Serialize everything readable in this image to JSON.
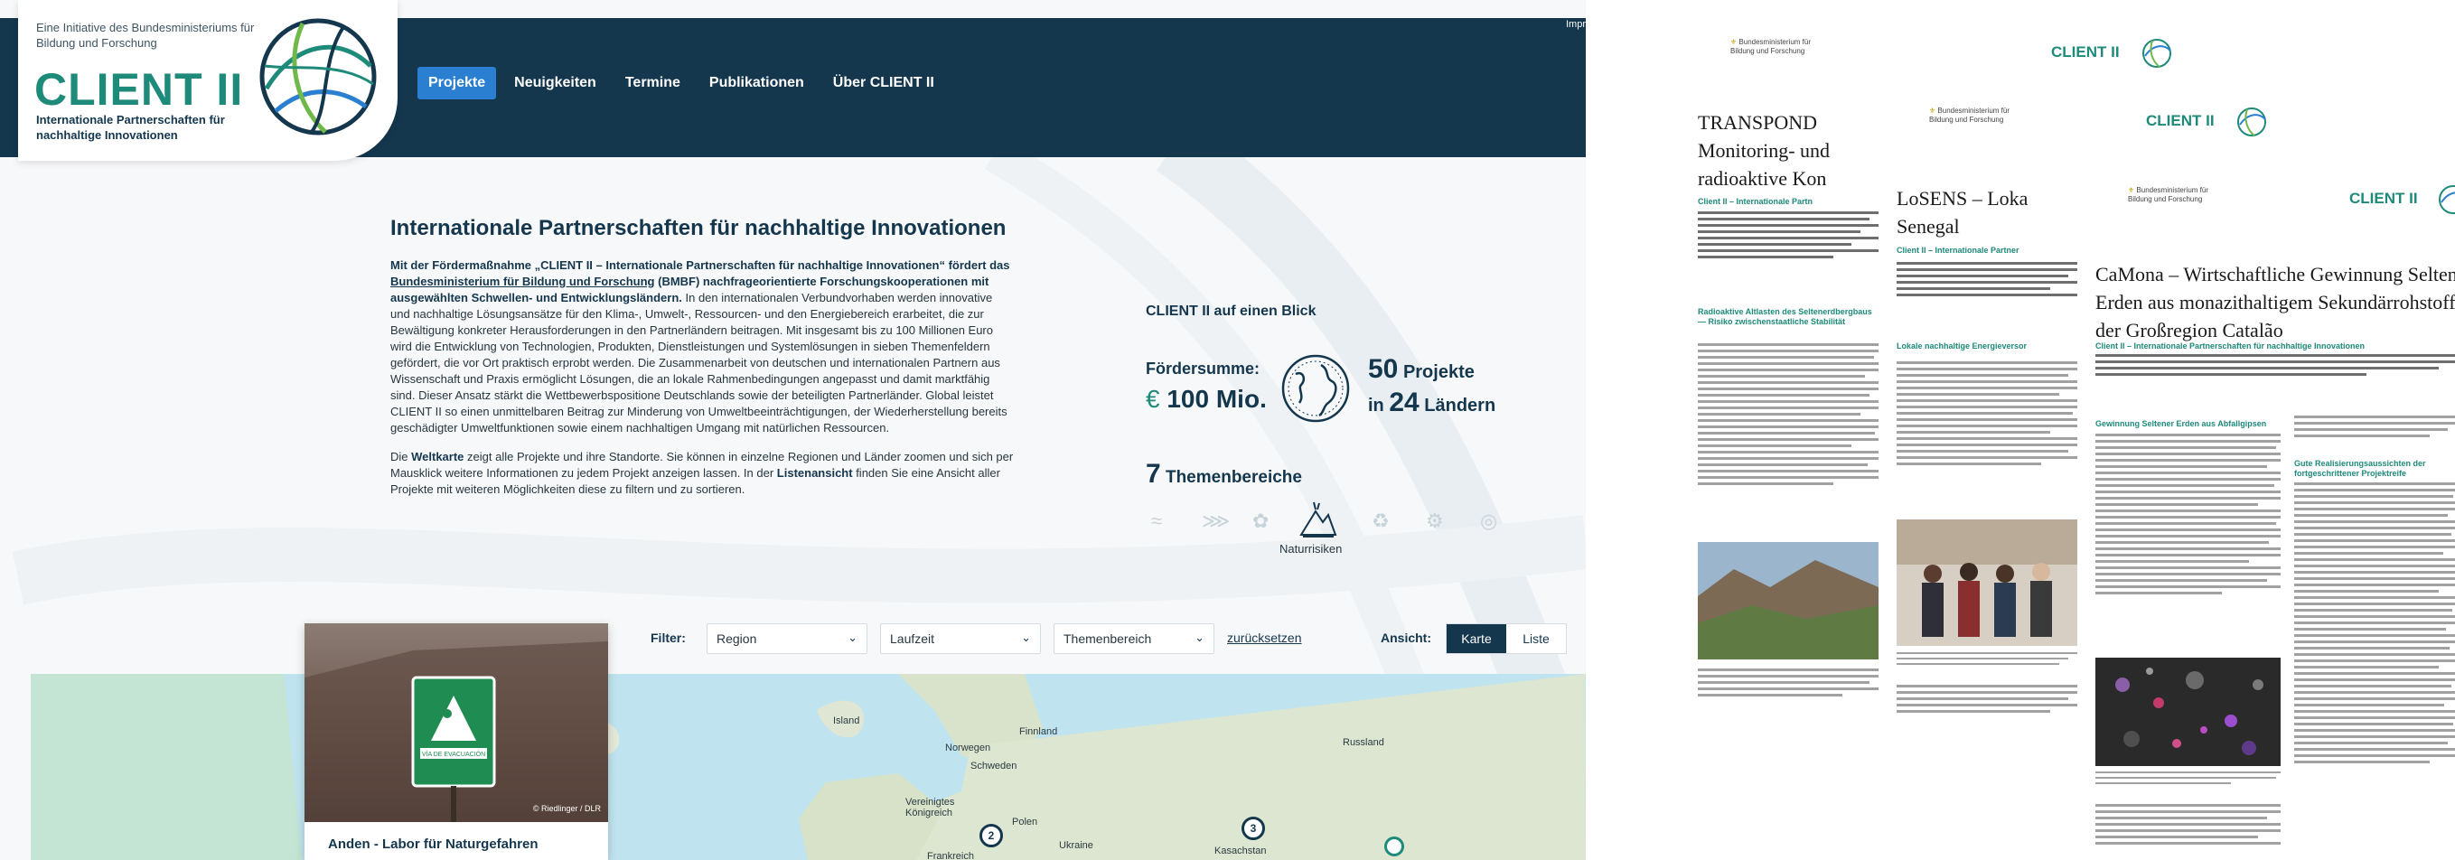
{
  "site": {
    "logo": {
      "initiative": "Eine Initiative des Bundesministeriums für Bildung und Forschung",
      "title": "CLIENT II",
      "subtitle": "Internationale Partnerschaften für nachhaltige Innovationen"
    },
    "nav": {
      "items": [
        "Projekte",
        "Neuigkeiten",
        "Termine",
        "Publikationen",
        "Über CLIENT II"
      ],
      "active": "Projekte",
      "imprint": "Impr"
    },
    "intro": {
      "heading": "Internationale Partnerschaften für nachhaltige Innovationen",
      "p1_bold1": "Mit der Fördermaßnahme „CLIENT II – Internationale Partnerschaften für nachhaltige Innovationen“ fördert das ",
      "p1_link": "Bundesministerium für Bildung und Forschung",
      "p1_bold2": " (BMBF) nachfrageorientierte Forschungskooperationen mit ausgewählten Schwellen- und Entwicklungsländern.",
      "p1_rest": " In den internationalen Verbundvorhaben werden innovative und nachhaltige Lösungsansätze für den Klima-, Umwelt-, Ressourcen- und den Energiebereich erarbeitet, die zur Bewältigung konkreter Herausforderungen in den Partnerländern beitragen. Mit insgesamt bis zu 100 Millionen Euro wird die Entwicklung von Technologien, Produkten, Dienstleistungen und Systemlösungen in sieben Themenfeldern gefördert, die vor Ort praktisch erprobt werden. Die Zusammenarbeit von deutschen und internationalen Partnern aus Wissenschaft und Praxis ermöglicht Lösungen, die an lokale Rahmenbedingungen angepasst und damit marktfähig sind. Dieser Ansatz stärkt die Wettbewerbspositione Deutschlands sowie der beteiligten Partnerländer. Global leistet CLIENT II so einen unmittelbaren Beitrag zur Minderung von Umweltbeeinträchtigungen, der Wiederherstellung bereits geschädigter Umweltfunktionen sowie einem nachhaltigen Umgang mit natürlichen Ressourcen.",
      "p2_a": "Die ",
      "p2_b1": "Weltkarte",
      "p2_c": " zeigt alle Projekte und ihre Standorte. Sie können in einzelne Regionen und Länder zoomen und sich per Mausklick weitere Informationen zu jedem Projekt anzeigen lassen. In der ",
      "p2_b2": "Listenansicht",
      "p2_d": " finden Sie eine Ansicht aller Projekte mit weiteren Möglichkeiten diese zu filtern und zu sortieren."
    },
    "glance": {
      "title": "CLIENT II auf einen Blick",
      "funding_label": "Fördersumme:",
      "funding_currency": "€",
      "funding_value": "100 Mio.",
      "projects_num": "50",
      "projects_label": "Projekte",
      "countries_prefix": "in",
      "countries_num": "24",
      "countries_label": "Ländern",
      "themes_num": "7",
      "themes_label": "Themenbereiche",
      "active_theme": "Naturrisiken",
      "icons": [
        "water-icon",
        "fish-icon",
        "plant-icon",
        "mountain-hazard-icon",
        "recycle-icon",
        "energy-icon",
        "land-icon"
      ]
    },
    "filters": {
      "label": "Filter:",
      "region": "Region",
      "laufzeit": "Laufzeit",
      "themenbereich": "Themenbereich",
      "reset": "zurücksetzen",
      "view_label": "Ansicht:",
      "view_map": "Karte",
      "view_list": "Liste"
    },
    "card": {
      "credit": "© Riedlinger / DLR",
      "title": "Anden - Labor für Naturgefahren",
      "sign_text": "VÍA DE EVACUACIÓN"
    },
    "map": {
      "labels": [
        "Island",
        "Finnland",
        "Norwegen",
        "Schweden",
        "Russland",
        "Vereinigtes Königreich",
        "Polen",
        "Ukraine",
        "Kasachstan",
        "Frankreich"
      ],
      "markers": [
        "2",
        "3"
      ]
    }
  },
  "documents": [
    {
      "title": "TRANSPOND Monitoring- und radioaktive Kon",
      "programme": "Client II – Internationale Partn",
      "section": "Radioaktive Altlasten des Seltenerdbergbaus — Risiko zwischenstaatliche Stabilität",
      "bmbf": "Bundesministerium für Bildung und Forschung"
    },
    {
      "title": "LoSENS – Loka Senegal",
      "programme": "Client II – Internationale Partner",
      "section": "Lokale nachhaltige Energieversor",
      "bmbf": "Bundesministerium für Bildung und Forschung"
    },
    {
      "title": "CaMona – Wirtschaftliche Gewinnung Seltener Erden aus monazithaltigem Sekundärrohstoff der Großregion Catalão",
      "programme": "Client II – Internationale Partnerschaften für nachhaltige Innovationen",
      "section1": "Gewinnung Seltener Erden aus Abfallgipsen",
      "section2": "Gute Realisierungsaussichten der fortgeschrittener Projektreife",
      "bmbf": "Bundesministerium für Bildung und Forschung"
    }
  ],
  "mini_logo": "CLIENT II",
  "colors": {
    "navy": "#14374e",
    "teal": "#1e8a7a",
    "active_nav": "#2a7fd1",
    "map_water": "#bfe4ef",
    "map_land": "#dfe7d4"
  }
}
